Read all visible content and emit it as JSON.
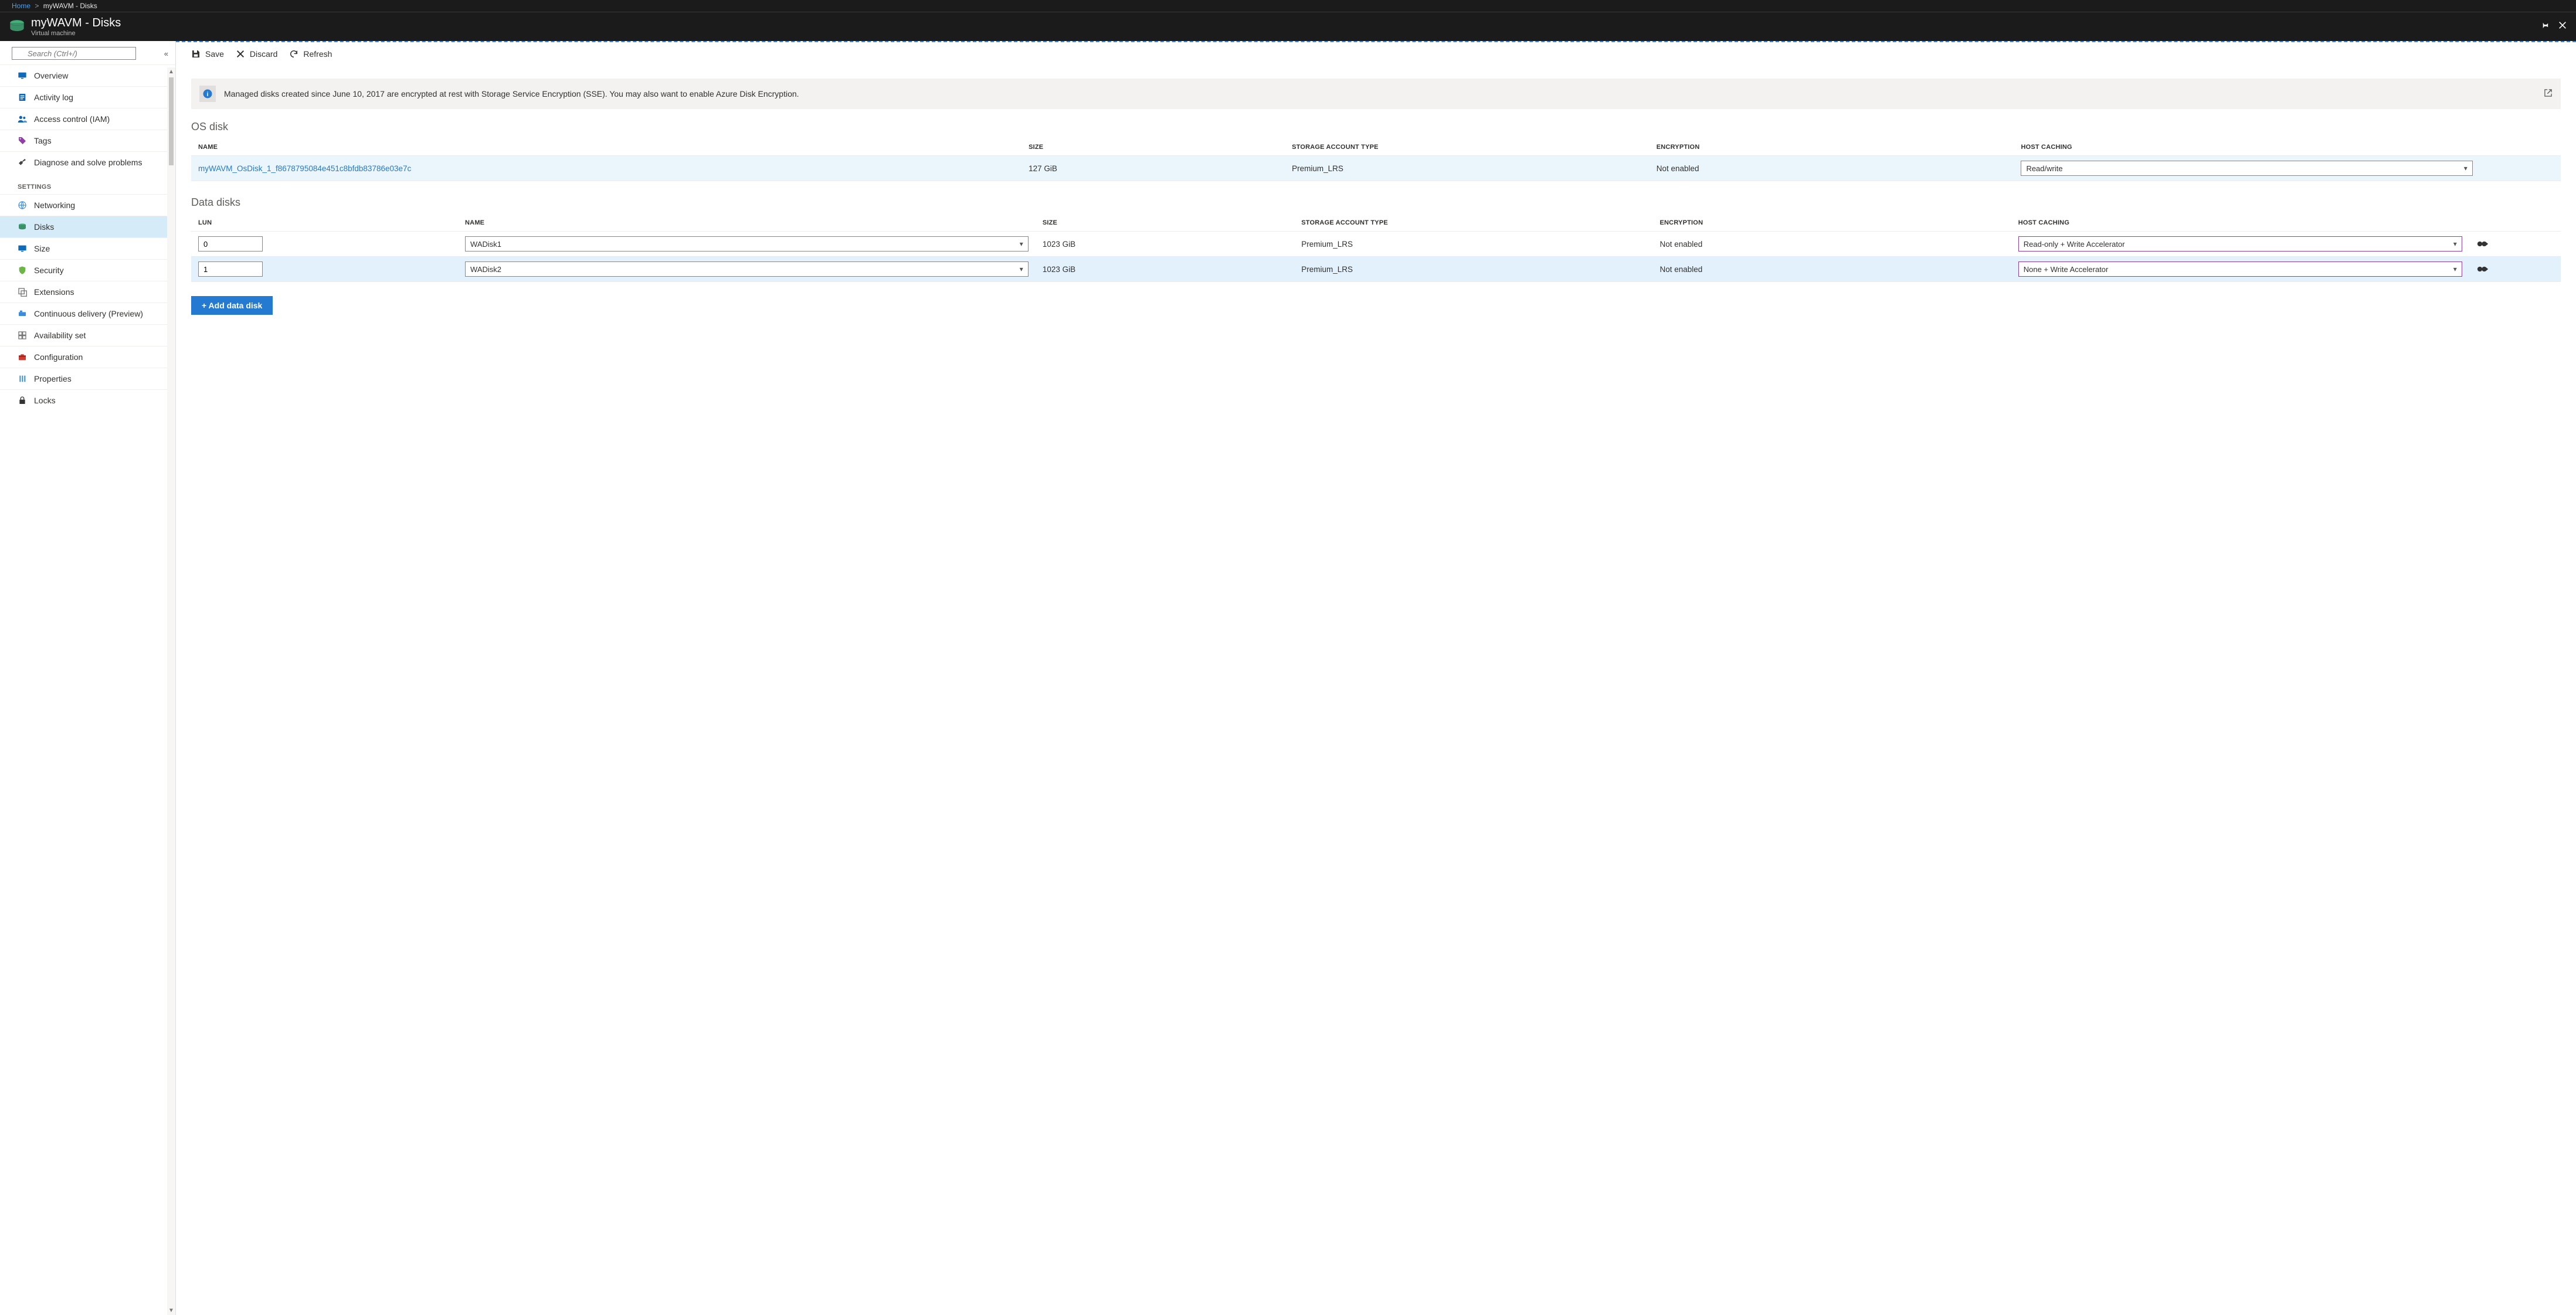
{
  "breadcrumb": {
    "home": "Home",
    "current": "myWAVM - Disks"
  },
  "header": {
    "title": "myWAVM - Disks",
    "subtitle": "Virtual machine"
  },
  "search": {
    "placeholder": "Search (Ctrl+/)"
  },
  "sidebar": {
    "top": [
      {
        "label": "Overview",
        "icon": "monitor",
        "color": "#0f6bb8"
      },
      {
        "label": "Activity log",
        "icon": "log",
        "color": "#1267b5"
      },
      {
        "label": "Access control (IAM)",
        "icon": "people",
        "color": "#1267b5"
      },
      {
        "label": "Tags",
        "icon": "tag",
        "color": "#8f3fa6"
      },
      {
        "label": "Diagnose and solve problems",
        "icon": "tools",
        "color": "#444"
      }
    ],
    "group_header": "SETTINGS",
    "settings": [
      {
        "label": "Networking",
        "icon": "globe",
        "color": "#3a8dde"
      },
      {
        "label": "Disks",
        "icon": "disk",
        "color": "#45b07c",
        "active": true
      },
      {
        "label": "Size",
        "icon": "monitor",
        "color": "#0f6bb8"
      },
      {
        "label": "Security",
        "icon": "shield",
        "color": "#6bb644"
      },
      {
        "label": "Extensions",
        "icon": "ext",
        "color": "#777"
      },
      {
        "label": "Continuous delivery (Preview)",
        "icon": "ship",
        "color": "#3a8dde"
      },
      {
        "label": "Availability set",
        "icon": "avail",
        "color": "#777"
      },
      {
        "label": "Configuration",
        "icon": "config",
        "color": "#d23a2f"
      },
      {
        "label": "Properties",
        "icon": "props",
        "color": "#3a8dde"
      },
      {
        "label": "Locks",
        "icon": "lock",
        "color": "#333"
      }
    ]
  },
  "toolbar": {
    "save": "Save",
    "discard": "Discard",
    "refresh": "Refresh"
  },
  "banner": "Managed disks created since June 10, 2017 are encrypted at rest with Storage Service Encryption (SSE). You may also want to enable Azure Disk Encryption.",
  "sections": {
    "os": "OS disk",
    "data": "Data disks"
  },
  "columns": {
    "lun": "LUN",
    "name": "NAME",
    "size": "SIZE",
    "storage": "STORAGE ACCOUNT TYPE",
    "encryption": "ENCRYPTION",
    "host": "HOST CACHING"
  },
  "os_disk": {
    "name": "myWAVM_OsDisk_1_f8678795084e451c8bfdb83786e03e7c",
    "size": "127 GiB",
    "storage": "Premium_LRS",
    "encryption": "Not enabled",
    "host": "Read/write"
  },
  "data_disks": [
    {
      "lun": "0",
      "name": "WADisk1",
      "size": "1023 GiB",
      "storage": "Premium_LRS",
      "encryption": "Not enabled",
      "host": "Read-only + Write Accelerator"
    },
    {
      "lun": "1",
      "name": "WADisk2",
      "size": "1023 GiB",
      "storage": "Premium_LRS",
      "encryption": "Not enabled",
      "host": "None + Write Accelerator"
    }
  ],
  "add_button": "+ Add data disk"
}
